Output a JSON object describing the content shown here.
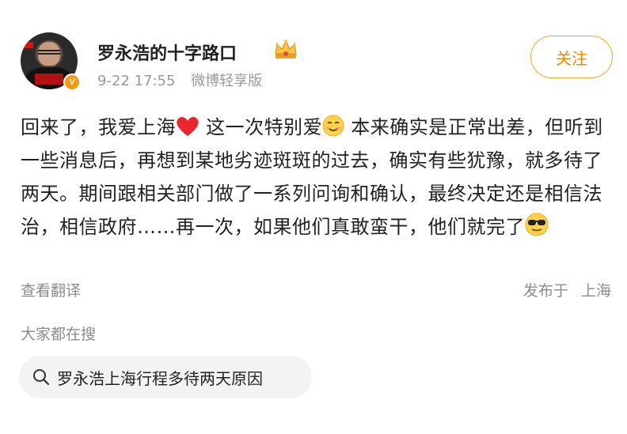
{
  "post": {
    "author": "罗永浩的十字路口",
    "time": "9-22 17:55",
    "source": "微博轻享版",
    "follow_label": "关注",
    "text_segments": [
      "回来了，我爱上海",
      " 这一次特别爱",
      " 本来确实是正常出差，但听到一些消息后，再想到某地劣迹斑斑的过去，确实有些犹豫，就多待了两天。期间跟相关部门做了一系列问询和确认，最终决定还是相信法治，相信政府……再一次，如果他们真敢蛮干，他们就完了"
    ],
    "translate_label": "查看翻译",
    "location_prefix": "发布于",
    "location": "上海"
  },
  "trending": {
    "title": "大家都在搜",
    "query": "罗永浩上海行程多待两天原因"
  },
  "icons": {
    "verified": "verified-v-icon",
    "crown": "crown-icon",
    "heart": "red-heart-emoji",
    "smile": "smiling-face-emoji",
    "cool": "sunglasses-face-emoji",
    "search": "search-icon"
  },
  "colors": {
    "accent": "#f5a623",
    "verified": "#f39a12",
    "muted": "#8c8c8c"
  }
}
